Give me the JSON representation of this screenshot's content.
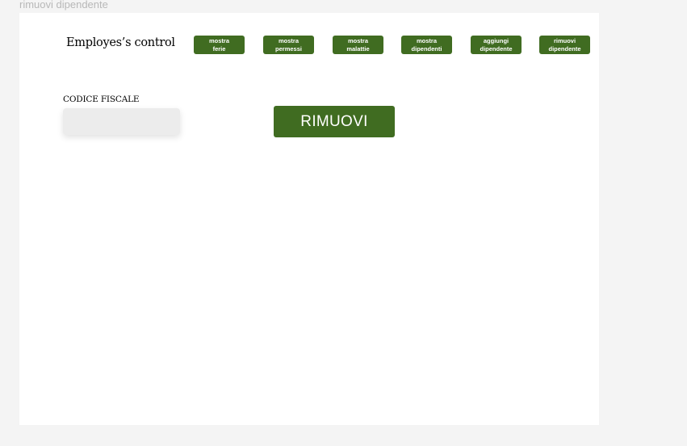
{
  "frame": {
    "title": "rimuovi dipendente"
  },
  "header": {
    "brand": "Employes’s control",
    "nav": [
      {
        "line1": "mostra",
        "line2": "ferie"
      },
      {
        "line1": "mostra",
        "line2": "permessi"
      },
      {
        "line1": "mostra",
        "line2": "malattie"
      },
      {
        "line1": "mostra",
        "line2": "dipendenti"
      },
      {
        "line1": "aggiungi",
        "line2": "dipendente"
      },
      {
        "line1": "rimuovi",
        "line2": "dipendente"
      }
    ]
  },
  "form": {
    "label": "CODICE FISCALE",
    "input_value": "",
    "input_placeholder": "",
    "submit_label": "RIMUOVI"
  },
  "colors": {
    "accent": "#406c21",
    "page_bg": "#f4f4f4",
    "input_bg": "#ececec"
  }
}
